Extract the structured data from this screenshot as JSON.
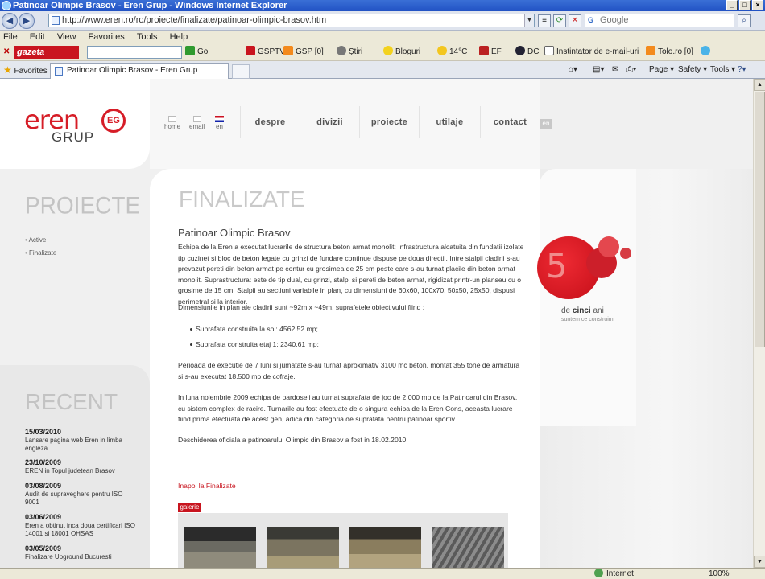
{
  "window": {
    "title": "Patinoar Olimpic Brasov - Eren Grup - Windows Internet Explorer",
    "url": "http://www.eren.ro/ro/proiecte/finalizate/patinoar-olimpic-brasov.htm",
    "search_placeholder": "Google"
  },
  "menu": [
    "File",
    "Edit",
    "View",
    "Favorites",
    "Tools",
    "Help"
  ],
  "toolbar": {
    "gazeta": "gazeta",
    "go": "Go",
    "items": [
      "GSPTV",
      "GSP  [0]",
      "Ştiri",
      "Bloguri",
      "14°C",
      "EF",
      "DC",
      "Instintator de e-mail-uri",
      "Tolo.ro  [0]"
    ]
  },
  "tabs": {
    "favorites": "Favorites",
    "active_tab": "Patinoar Olimpic Brasov - Eren Grup",
    "commands": [
      "Page",
      "Safety",
      "Tools"
    ]
  },
  "status": {
    "zone": "Internet",
    "zoom": "100%"
  },
  "site": {
    "logo_main": "eren",
    "logo_sub": "GRUP",
    "logo_badge": "EG",
    "quick_links": [
      "home",
      "email",
      "en"
    ],
    "nav": [
      "despre",
      "divizii",
      "proiecte",
      "utilaje",
      "contact"
    ],
    "lang_chip": "en",
    "side_title": "PROIECTE",
    "side_links": [
      "Active",
      "Finalizate"
    ],
    "recent_title": "RECENT",
    "news": [
      {
        "date": "15/03/2010",
        "text": "Lansare pagina web Eren in limba engleza"
      },
      {
        "date": "23/10/2009",
        "text": "EREN in Topul judetean Brasov"
      },
      {
        "date": "03/08/2009",
        "text": "Audit de supraveghere pentru ISO 9001"
      },
      {
        "date": "03/06/2009",
        "text": "Eren a obtinut inca doua certificari ISO 14001 si 18001 OHSAS"
      },
      {
        "date": "03/05/2009",
        "text": "Finalizare Upground Bucuresti"
      }
    ],
    "badge_number": "5",
    "badge_tagline_pre": "de ",
    "badge_tagline_bold": "cinci",
    "badge_tagline_post": " ani",
    "badge_sub": "suntem ce construim"
  },
  "article": {
    "section": "FINALIZATE",
    "title": "Patinoar Olimpic Brasov",
    "p1": "Echipa de la Eren a executat lucrarile de structura beton armat monolit: Infrastructura alcatuita din fundatii izolate tip cuzinet si bloc de beton legate cu grinzi de fundare continue dispuse pe doua directii. Intre stalpii cladirii s-au prevazut pereti din beton armat pe contur cu grosimea de 25 cm peste care s-au turnat placile din beton armat monolit. Suprastructura: este de tip dual, cu grinzi, stalpi si pereti de beton armat, rigidizat printr-un planseu cu o grosime de 15 cm. Stalpii au sectiuni variabile in plan, cu dimensiuni de 60x60, 100x70, 50x50, 25x50, dispusi perimetral si la interior.",
    "p2": "Dimensiunile in plan ale cladirii sunt ~92m x ~49m, suprafetele obiectivului fiind :",
    "bullets": [
      "Suprafata construita la sol: 4562,52 mp;",
      "Suprafata construita etaj 1: 2340,61 mp;"
    ],
    "p3": "Perioada de executie de 7 luni si jumatate s-au turnat aproximativ 3100 mc beton, montat 355 tone de armatura si s-au executat 18.500 mp de cofraje.",
    "p4": "In luna noiembrie 2009 echipa de pardoseli au turnat suprafata de joc de 2 000 mp de la Patinoarul din Brasov, cu sistem complex de racire. Turnarile au fost efectuate de o singura echipa de la Eren Cons, aceasta lucrare fiind prima efectuata de acest gen, adica din categoria de suprafata pentru patinoar sportiv.",
    "p5": "Deschiderea oficiala a patinoarului Olimpic din Brasov a fost in 18.02.2010.",
    "back_link": "Inapoi la Finalizate",
    "gallery_label": "galerie"
  },
  "colors": {
    "brand_red": "#d61d27",
    "title_gray": "#c3c3c3"
  }
}
